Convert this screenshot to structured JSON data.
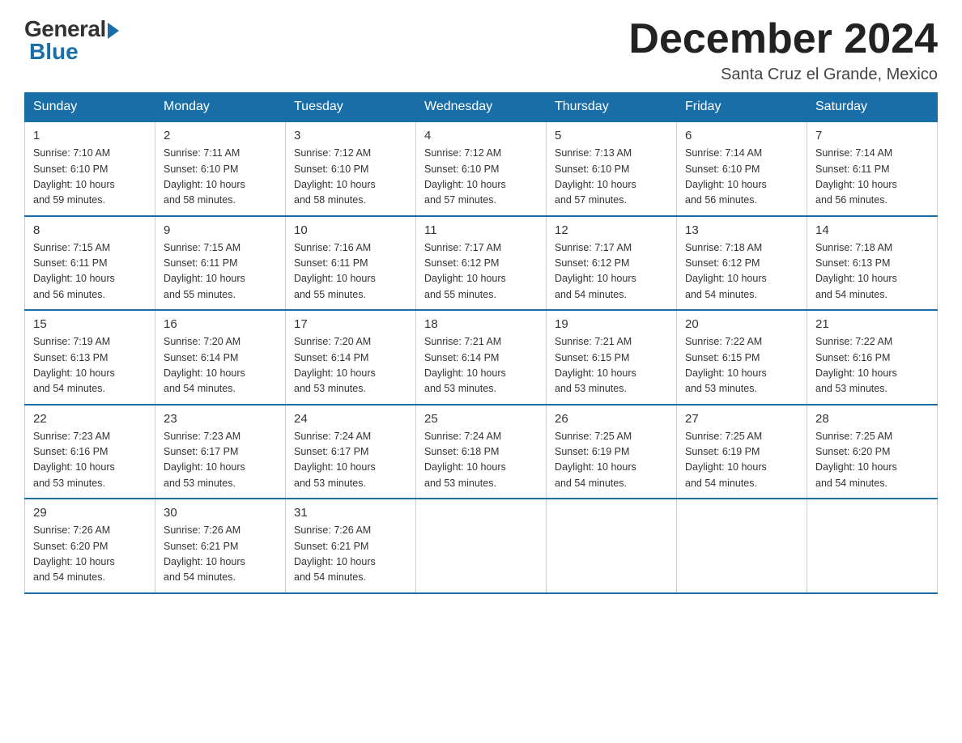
{
  "logo": {
    "general": "General",
    "blue": "Blue"
  },
  "title": "December 2024",
  "location": "Santa Cruz el Grande, Mexico",
  "days_of_week": [
    "Sunday",
    "Monday",
    "Tuesday",
    "Wednesday",
    "Thursday",
    "Friday",
    "Saturday"
  ],
  "weeks": [
    [
      {
        "day": "1",
        "sunrise": "7:10 AM",
        "sunset": "6:10 PM",
        "daylight": "10 hours and 59 minutes."
      },
      {
        "day": "2",
        "sunrise": "7:11 AM",
        "sunset": "6:10 PM",
        "daylight": "10 hours and 58 minutes."
      },
      {
        "day": "3",
        "sunrise": "7:12 AM",
        "sunset": "6:10 PM",
        "daylight": "10 hours and 58 minutes."
      },
      {
        "day": "4",
        "sunrise": "7:12 AM",
        "sunset": "6:10 PM",
        "daylight": "10 hours and 57 minutes."
      },
      {
        "day": "5",
        "sunrise": "7:13 AM",
        "sunset": "6:10 PM",
        "daylight": "10 hours and 57 minutes."
      },
      {
        "day": "6",
        "sunrise": "7:14 AM",
        "sunset": "6:10 PM",
        "daylight": "10 hours and 56 minutes."
      },
      {
        "day": "7",
        "sunrise": "7:14 AM",
        "sunset": "6:11 PM",
        "daylight": "10 hours and 56 minutes."
      }
    ],
    [
      {
        "day": "8",
        "sunrise": "7:15 AM",
        "sunset": "6:11 PM",
        "daylight": "10 hours and 56 minutes."
      },
      {
        "day": "9",
        "sunrise": "7:15 AM",
        "sunset": "6:11 PM",
        "daylight": "10 hours and 55 minutes."
      },
      {
        "day": "10",
        "sunrise": "7:16 AM",
        "sunset": "6:11 PM",
        "daylight": "10 hours and 55 minutes."
      },
      {
        "day": "11",
        "sunrise": "7:17 AM",
        "sunset": "6:12 PM",
        "daylight": "10 hours and 55 minutes."
      },
      {
        "day": "12",
        "sunrise": "7:17 AM",
        "sunset": "6:12 PM",
        "daylight": "10 hours and 54 minutes."
      },
      {
        "day": "13",
        "sunrise": "7:18 AM",
        "sunset": "6:12 PM",
        "daylight": "10 hours and 54 minutes."
      },
      {
        "day": "14",
        "sunrise": "7:18 AM",
        "sunset": "6:13 PM",
        "daylight": "10 hours and 54 minutes."
      }
    ],
    [
      {
        "day": "15",
        "sunrise": "7:19 AM",
        "sunset": "6:13 PM",
        "daylight": "10 hours and 54 minutes."
      },
      {
        "day": "16",
        "sunrise": "7:20 AM",
        "sunset": "6:14 PM",
        "daylight": "10 hours and 54 minutes."
      },
      {
        "day": "17",
        "sunrise": "7:20 AM",
        "sunset": "6:14 PM",
        "daylight": "10 hours and 53 minutes."
      },
      {
        "day": "18",
        "sunrise": "7:21 AM",
        "sunset": "6:14 PM",
        "daylight": "10 hours and 53 minutes."
      },
      {
        "day": "19",
        "sunrise": "7:21 AM",
        "sunset": "6:15 PM",
        "daylight": "10 hours and 53 minutes."
      },
      {
        "day": "20",
        "sunrise": "7:22 AM",
        "sunset": "6:15 PM",
        "daylight": "10 hours and 53 minutes."
      },
      {
        "day": "21",
        "sunrise": "7:22 AM",
        "sunset": "6:16 PM",
        "daylight": "10 hours and 53 minutes."
      }
    ],
    [
      {
        "day": "22",
        "sunrise": "7:23 AM",
        "sunset": "6:16 PM",
        "daylight": "10 hours and 53 minutes."
      },
      {
        "day": "23",
        "sunrise": "7:23 AM",
        "sunset": "6:17 PM",
        "daylight": "10 hours and 53 minutes."
      },
      {
        "day": "24",
        "sunrise": "7:24 AM",
        "sunset": "6:17 PM",
        "daylight": "10 hours and 53 minutes."
      },
      {
        "day": "25",
        "sunrise": "7:24 AM",
        "sunset": "6:18 PM",
        "daylight": "10 hours and 53 minutes."
      },
      {
        "day": "26",
        "sunrise": "7:25 AM",
        "sunset": "6:19 PM",
        "daylight": "10 hours and 54 minutes."
      },
      {
        "day": "27",
        "sunrise": "7:25 AM",
        "sunset": "6:19 PM",
        "daylight": "10 hours and 54 minutes."
      },
      {
        "day": "28",
        "sunrise": "7:25 AM",
        "sunset": "6:20 PM",
        "daylight": "10 hours and 54 minutes."
      }
    ],
    [
      {
        "day": "29",
        "sunrise": "7:26 AM",
        "sunset": "6:20 PM",
        "daylight": "10 hours and 54 minutes."
      },
      {
        "day": "30",
        "sunrise": "7:26 AM",
        "sunset": "6:21 PM",
        "daylight": "10 hours and 54 minutes."
      },
      {
        "day": "31",
        "sunrise": "7:26 AM",
        "sunset": "6:21 PM",
        "daylight": "10 hours and 54 minutes."
      },
      null,
      null,
      null,
      null
    ]
  ],
  "labels": {
    "sunrise": "Sunrise:",
    "sunset": "Sunset:",
    "daylight": "Daylight:"
  }
}
